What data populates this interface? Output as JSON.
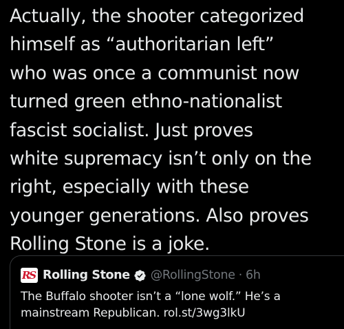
{
  "tweet": {
    "text": "Actually, the shooter categorized\nhimself as “authoritarian left”\nwho was once a communist now\nturned green ethno-nationalist\nfascist socialist. Just proves\nwhite supremacy isn’t only on the\nright, especially with these\nyounger generations. Also proves\nRolling Stone is a joke."
  },
  "quoted_tweet": {
    "logo_text": "RS",
    "author_name": "Rolling Stone",
    "verified_icon": "verified-badge-icon",
    "handle": "@RollingStone",
    "separator": "·",
    "time": "6h",
    "text": "The Buffalo shooter isn’t a “lone wolf.” He’s a mainstream Republican. rol.st/3wg3lkU"
  },
  "colors": {
    "background": "#000000",
    "text_primary": "#e7e9ea",
    "text_secondary": "#71767b",
    "card_border": "#333639",
    "brand_red": "#d0142b"
  }
}
